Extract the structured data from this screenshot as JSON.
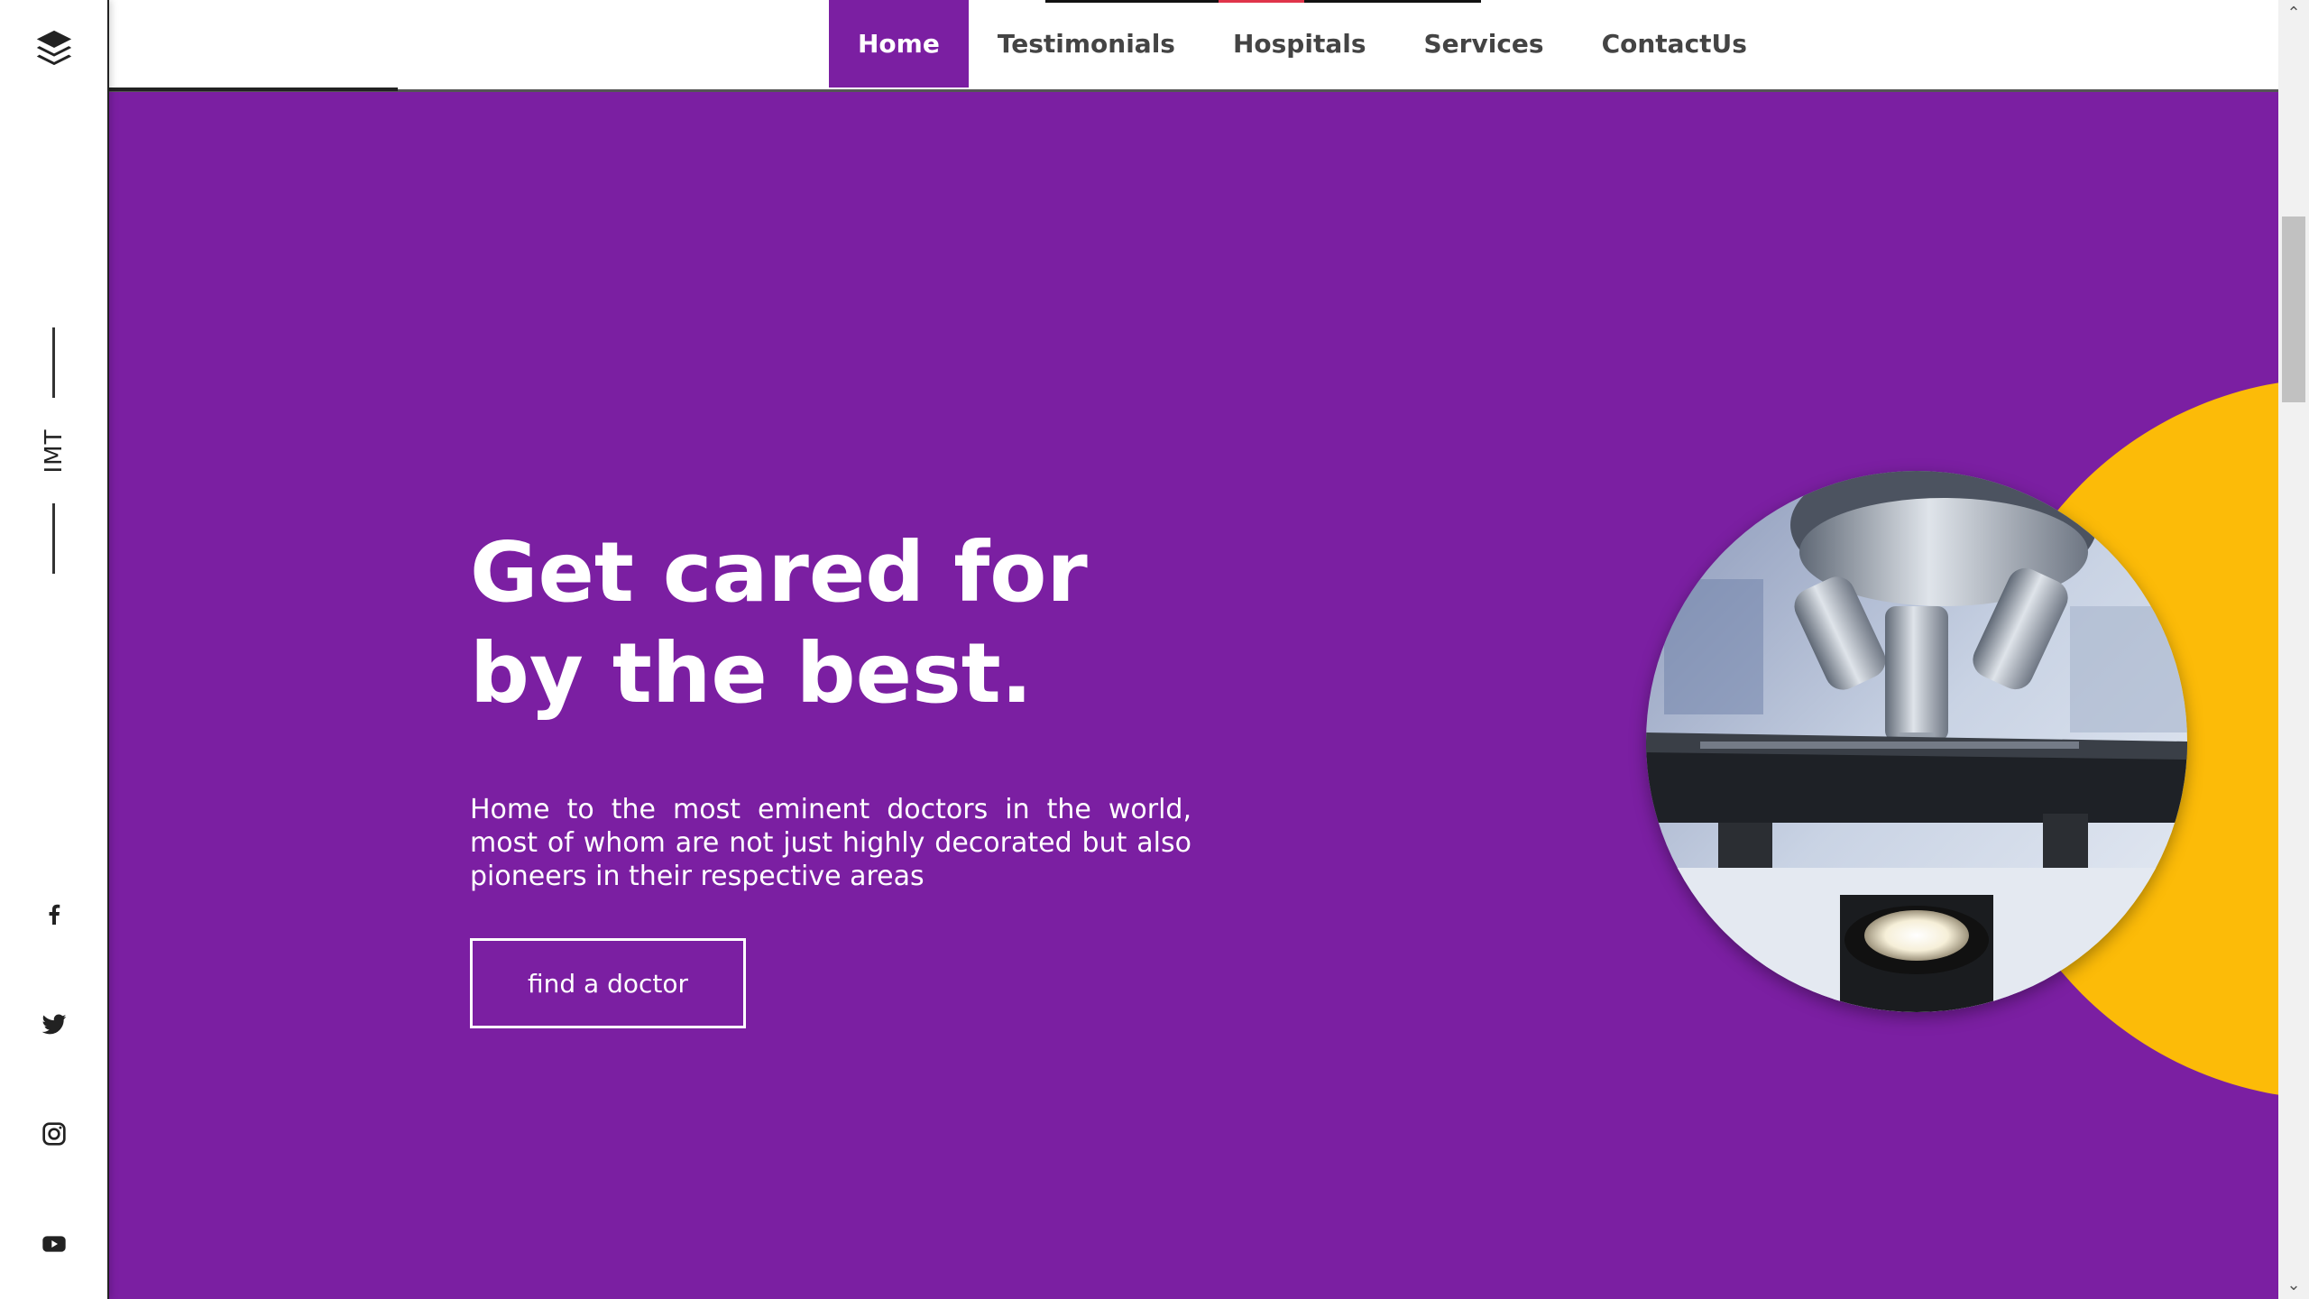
{
  "sidebar": {
    "brand": "IMT",
    "logo_icon": "layers-icon",
    "social": [
      "facebook-icon",
      "twitter-icon",
      "instagram-icon",
      "youtube-icon"
    ]
  },
  "nav": {
    "items": [
      {
        "label": "Home",
        "active": true
      },
      {
        "label": "Testimonials",
        "active": false
      },
      {
        "label": "Hospitals",
        "active": false
      },
      {
        "label": "Services",
        "active": false
      },
      {
        "label": "ContactUs",
        "active": false
      }
    ]
  },
  "hero": {
    "title": "Get cared for by the best.",
    "description": "Home to the most eminent doctors in the world, most of whom are not just highly decorated but also pioneers in their respective areas",
    "cta_label": "find a doctor",
    "image_icon": "microscope-photo"
  },
  "colors": {
    "primary": "#7b1fa2",
    "accent": "#fcbb08",
    "text_on_primary": "#ffffff"
  }
}
